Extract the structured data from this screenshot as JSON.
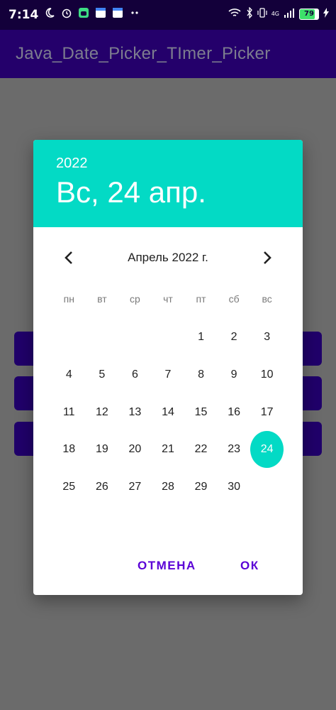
{
  "status_bar": {
    "time": "7:14",
    "network": "4G",
    "battery": "79"
  },
  "app_bar": {
    "title": "Java_Date_Picker_TImer_Picker"
  },
  "dialog": {
    "year": "2022",
    "selected_date": "Вс, 24 апр.",
    "month_label": "Апрель 2022 г.",
    "weekdays": [
      "пн",
      "вт",
      "ср",
      "чт",
      "пт",
      "сб",
      "вс"
    ],
    "weeks": [
      [
        "",
        "",
        "",
        "",
        "1",
        "2",
        "3"
      ],
      [
        "4",
        "5",
        "6",
        "7",
        "8",
        "9",
        "10"
      ],
      [
        "11",
        "12",
        "13",
        "14",
        "15",
        "16",
        "17"
      ],
      [
        "18",
        "19",
        "20",
        "21",
        "22",
        "23",
        "24"
      ],
      [
        "25",
        "26",
        "27",
        "28",
        "29",
        "30",
        ""
      ]
    ],
    "selected_day": "24",
    "cancel_label": "ОТМЕНА",
    "ok_label": "ОК"
  },
  "colors": {
    "accent": "#03dac5",
    "primary": "#24006b",
    "button_text": "#5a00d6",
    "scrim": "#6b6b6b"
  }
}
